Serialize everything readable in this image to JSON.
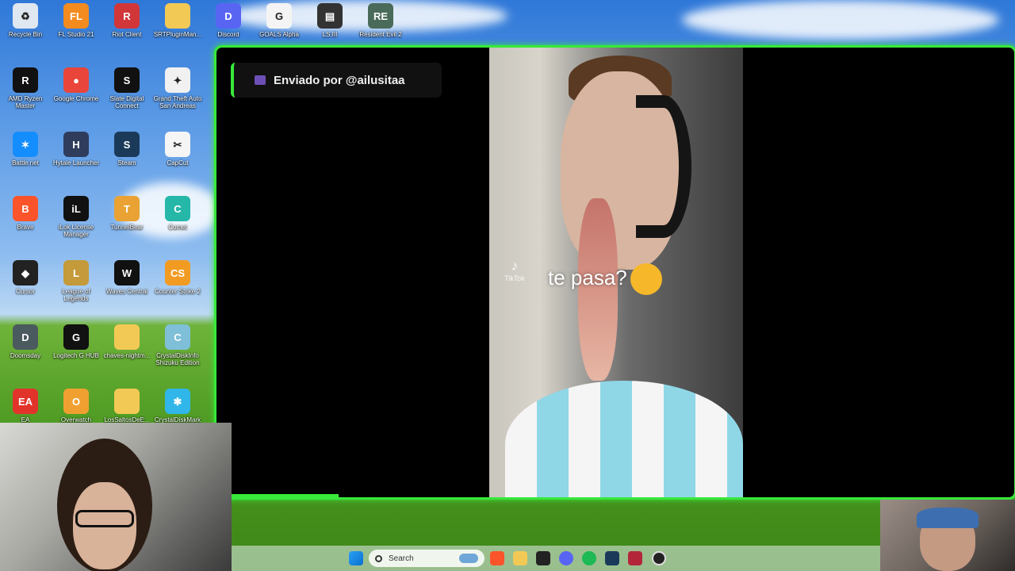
{
  "desktop": {
    "icons": [
      {
        "label": "Recycle Bin",
        "color": "#dfe8f1",
        "glyph": "♻"
      },
      {
        "label": "FL Studio 21",
        "color": "#f48b1f",
        "glyph": "FL"
      },
      {
        "label": "Riot Client",
        "color": "#d13639",
        "glyph": "R"
      },
      {
        "label": "SRTPluginMan...",
        "color": "#f3c955",
        "glyph": ""
      },
      {
        "label": "Discord",
        "color": "#5865f2",
        "glyph": "D"
      },
      {
        "label": "GOALS Alpha",
        "color": "#f4f4f4",
        "glyph": "G"
      },
      {
        "label": "LS.III",
        "color": "#333333",
        "glyph": "▤"
      },
      {
        "label": "Resident Evil 2",
        "color": "#4a6b5a",
        "glyph": "RE"
      },
      {
        "label": "AMD Ryzen Master",
        "color": "#111111",
        "glyph": "R"
      },
      {
        "label": "Google Chrome",
        "color": "#e9453a",
        "glyph": "●"
      },
      {
        "label": "Slate Digital Connect",
        "color": "#111111",
        "glyph": "S"
      },
      {
        "label": "Grand Theft Auto San Andreas",
        "color": "#f1f1f1",
        "glyph": "✦"
      },
      {
        "label": "Battle.net",
        "color": "#148eff",
        "glyph": "✶"
      },
      {
        "label": "Hytale Launcher",
        "color": "#2f3c5c",
        "glyph": "H"
      },
      {
        "label": "Steam",
        "color": "#1b3a5a",
        "glyph": "S"
      },
      {
        "label": "CapCut",
        "color": "#f5f5f5",
        "glyph": "✂"
      },
      {
        "label": "Brave",
        "color": "#fb542b",
        "glyph": "B"
      },
      {
        "label": "iLok License Manager",
        "color": "#111111",
        "glyph": "iL"
      },
      {
        "label": "TunnelBear",
        "color": "#e9a233",
        "glyph": "T"
      },
      {
        "label": "Comet",
        "color": "#25b7a8",
        "glyph": "C"
      },
      {
        "label": "Cursor",
        "color": "#222222",
        "glyph": "◆"
      },
      {
        "label": "League of Legends",
        "color": "#c49a3a",
        "glyph": "L"
      },
      {
        "label": "Waves Central",
        "color": "#111111",
        "glyph": "W"
      },
      {
        "label": "Counter Strike 2",
        "color": "#f29b22",
        "glyph": "CS"
      },
      {
        "label": "Doomsday",
        "color": "#4b5a5f",
        "glyph": "D"
      },
      {
        "label": "Logitech G HUB",
        "color": "#111111",
        "glyph": "G"
      },
      {
        "label": "chaves-nightm...",
        "color": "#f3c955",
        "glyph": ""
      },
      {
        "label": "CrystalDiskInfo Shizuku Edition",
        "color": "#7fbfd8",
        "glyph": "C"
      },
      {
        "label": "EA",
        "color": "#e2332b",
        "glyph": "EA"
      },
      {
        "label": "Overwatch",
        "color": "#f0a030",
        "glyph": "O"
      },
      {
        "label": "LosSaltosDeE...",
        "color": "#f3c955",
        "glyph": ""
      },
      {
        "label": "CrystalDiskMark",
        "color": "#30b6e8",
        "glyph": "✱"
      }
    ]
  },
  "overlay": {
    "sender": "Enviado por @ailusitaa",
    "video_caption": "te pasa?",
    "video_watermark": "TikTok",
    "accent_color": "#38e83a"
  },
  "taskbar": {
    "search_label": "Search",
    "apps": [
      "windows-start",
      "brave",
      "file-explorer",
      "cursor",
      "discord",
      "spotify",
      "steam",
      "streaming-app",
      "obs"
    ]
  }
}
